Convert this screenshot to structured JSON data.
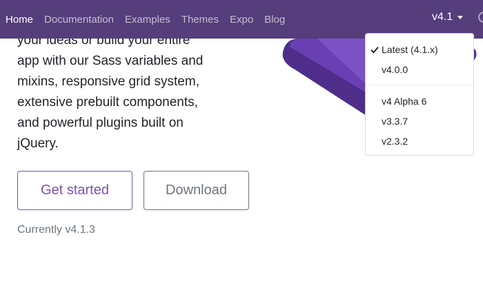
{
  "navbar": {
    "links": [
      {
        "label": "Home",
        "active": true
      },
      {
        "label": "Documentation"
      },
      {
        "label": "Examples"
      },
      {
        "label": "Themes"
      },
      {
        "label": "Expo"
      },
      {
        "label": "Blog"
      }
    ],
    "version_toggle": "v4.1"
  },
  "hero": {
    "lead_lines": [
      "your ideas or build your entire",
      "app with our Sass variables and",
      "mixins, responsive grid system,",
      "extensive prebuilt components,",
      "and powerful plugins built on",
      "jQuery."
    ],
    "primary_button": "Get started",
    "secondary_button": "Download",
    "currently": "Currently v4.1.3"
  },
  "version_dropdown": {
    "items": [
      {
        "label": "Latest (4.1.x)",
        "checked": true
      },
      {
        "label": "v4.0.0"
      },
      {
        "label": "v4 Alpha 6"
      },
      {
        "label": "v3.3.7"
      },
      {
        "label": "v2.3.2"
      }
    ]
  },
  "colors": {
    "navbar": "#563d7c",
    "brand_purple": "#7952b3",
    "muted": "#6c757d"
  },
  "icons": {
    "check": "check-icon",
    "caret": "caret-down-icon",
    "partial_nav_icon": "github-icon"
  }
}
